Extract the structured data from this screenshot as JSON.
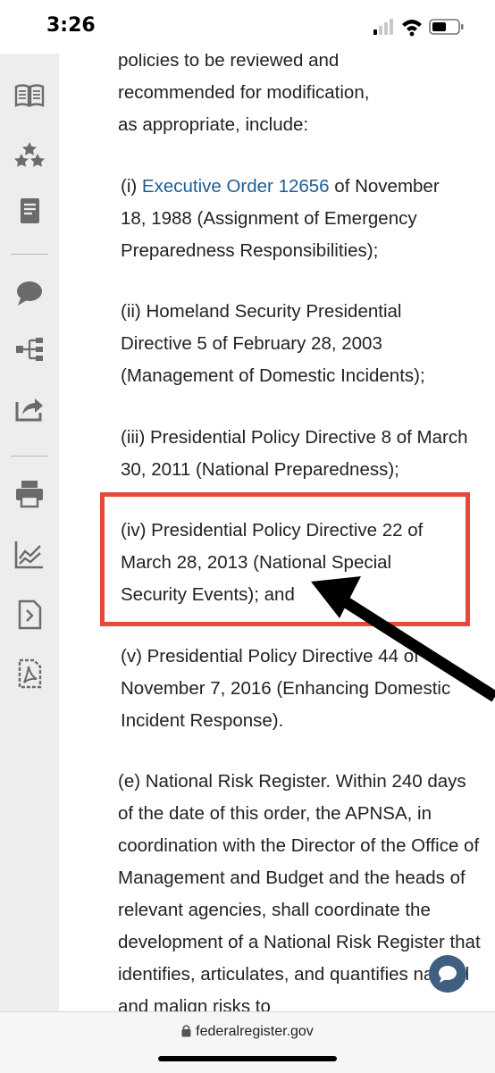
{
  "status_bar": {
    "time": "3:26"
  },
  "sidebar": {
    "icons": [
      "book-icon",
      "stars-icon",
      "document-icon",
      "comment-icon",
      "sitemap-icon",
      "share-icon",
      "print-icon",
      "chart-icon",
      "file-arrow-icon",
      "pdf-icon"
    ]
  },
  "article": {
    "intro": "policies to be reviewed and recommended for modification, as appropriate, include:",
    "item_i_prefix": "(i) ",
    "item_i_link": "Executive Order 12656",
    "item_i_suffix": " of November 18, 1988 (Assignment of Emergency Preparedness Responsibilities);",
    "item_ii": "(ii) Homeland Security Presidential Directive 5 of February 28, 2003 (Management of Domestic Incidents);",
    "item_iii": "(iii) Presidential Policy Directive 8 of March 30, 2011 (National Preparedness);",
    "item_iv": "(iv) Presidential Policy Directive 22 of March 28, 2013 (National Special Security Events); and",
    "item_v": "(v) Presidential Policy Directive 44 of November 7, 2016 (Enhancing Domestic Incident Response).",
    "section_e": "(e) National Risk Register. Within 240 days of the date of this order, the APNSA, in coordination with the Director of the Office of Management and Budget and the heads of relevant agencies, shall coordinate the development of a National Risk Register that identifies, articulates, and quantifies natural and malign risks to"
  },
  "colors": {
    "link": "#1f5d94",
    "highlight": "#e44a3b",
    "chat": "#3f5e80"
  },
  "url_bar": {
    "url": "federalregister.gov"
  }
}
